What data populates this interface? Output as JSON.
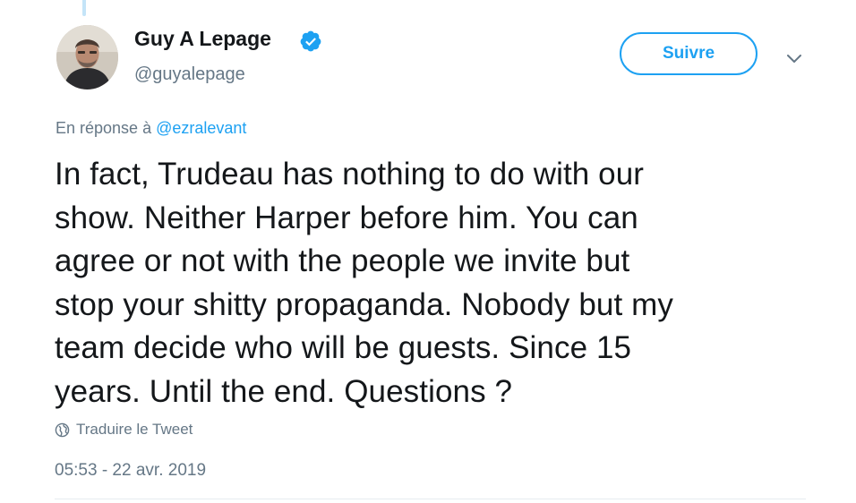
{
  "tweet": {
    "author": {
      "display_name": "Guy A Lepage",
      "handle": "@guyalepage",
      "verified": true,
      "avatar_icon": "profile-photo"
    },
    "follow_label": "Suivre",
    "menu_icon": "chevron-down-icon",
    "reply_prefix": "En réponse à",
    "reply_to": "@ezralevant",
    "text_lines": [
      "In fact, Trudeau has nothing to do with our",
      "show. Neither Harper before him. You can",
      "agree or not with the people we invite but",
      "stop your shitty propaganda. Nobody but my",
      "team decide who will be guests. Since 15",
      "years. Until the end. Questions ?"
    ],
    "translate_label": "Traduire le Tweet",
    "translate_icon": "globe-icon",
    "timestamp": "05:53 - 22 avr. 2019"
  },
  "colors": {
    "accent": "#1da1f2",
    "secondary_text": "#657786",
    "primary_text": "#14171a",
    "divider": "#e6ecf0"
  }
}
